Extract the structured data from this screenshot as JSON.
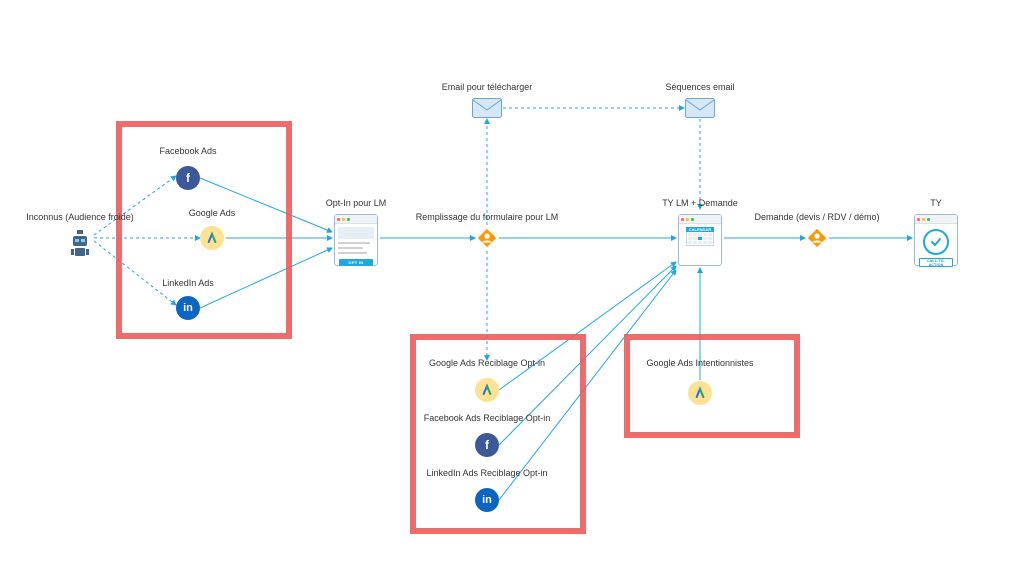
{
  "nodes": {
    "inconnus": "Inconnus (Audience froide)",
    "cold": {
      "facebook": "Facebook Ads",
      "google": "Google Ads",
      "linkedin": "LinkedIn Ads"
    },
    "optin": {
      "label": "Opt-In pour LM",
      "button": "OPT IN"
    },
    "form_fill": "Remplissage du formulaire pour LM",
    "email_dl": "Email pour télécharger",
    "email_seq": "Séquences email",
    "ty_lm": {
      "label": "TY LM + Demande",
      "cal_header": "CALENDAR"
    },
    "demande": "Demande (devis / RDV / démo)",
    "ty": {
      "label": "TY",
      "button": "CALL-TO-ACTION"
    },
    "retarget": {
      "google": "Google Ads Reciblage Opt-in",
      "facebook": "Facebook Ads Reciblage Opt-in",
      "linkedin": "LinkedIn Ads Reciblage Opt-in"
    },
    "intent": {
      "google": "Google Ads Intentionnistes"
    }
  },
  "colors": {
    "facebook": "#3b5998",
    "linkedin": "#0a66c2",
    "google_bg": "#fde293",
    "accent": "#1fa8e0",
    "marker": "#ff9800",
    "box_border": "#ec5858"
  }
}
